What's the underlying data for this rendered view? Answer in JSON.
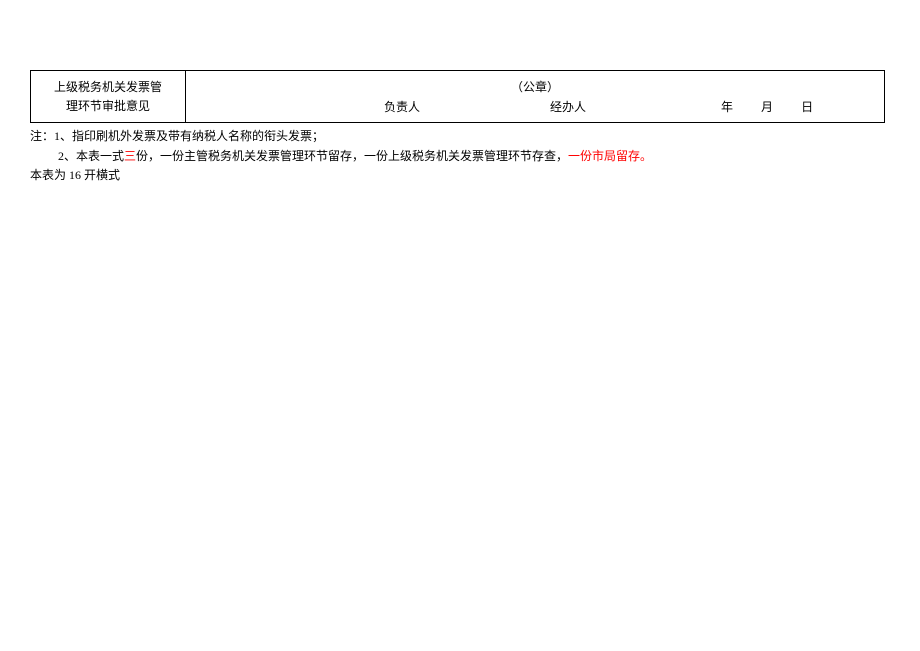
{
  "table": {
    "row_label_line1": "上级税务机关发票管",
    "row_label_line2": "理环节审批意见",
    "seal": "（公章）",
    "person_in_charge": "负责人",
    "handler": "经办人",
    "year": "年",
    "month": "月",
    "day": "日"
  },
  "notes": {
    "prefix": "注：",
    "note1": "1、指印刷机外发票及带有纳税人名称的衔头发票；",
    "note2_part1": "2、本表一式",
    "note2_red1": "三",
    "note2_part2": "份，一份主管税务机关发票管理环节留存，一份上级税务机关发票管理环节存查，",
    "note2_red2": "一份市局留存。"
  },
  "format": "本表为 16 开横式"
}
